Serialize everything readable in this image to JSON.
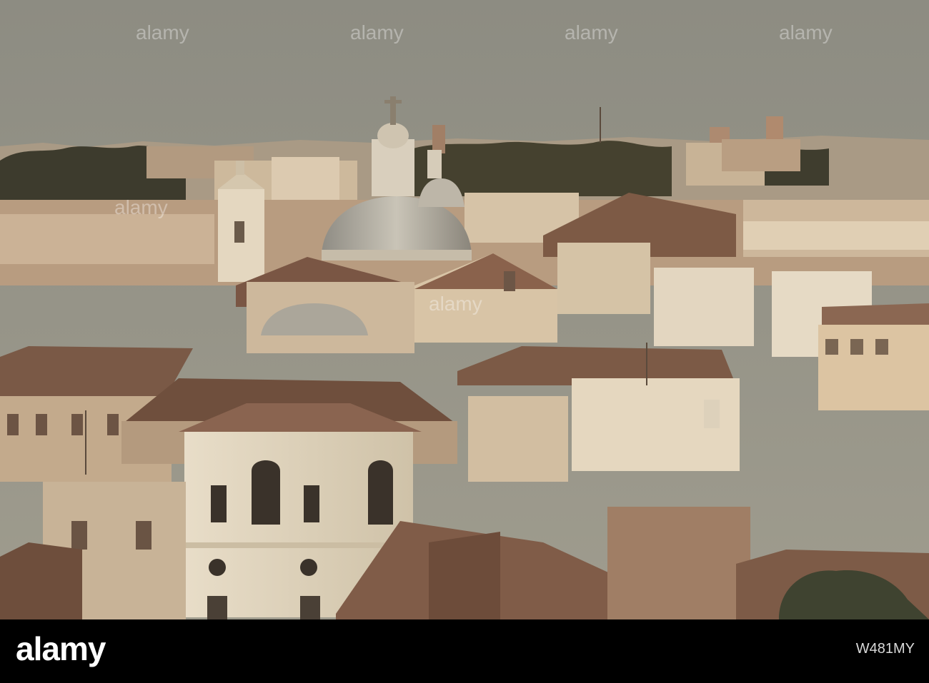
{
  "image": {
    "subject": "rome-skyline-rooftops",
    "palette": {
      "sky": "#8c8a7e",
      "distant": "#b7a790",
      "roof_dark": "#6e4a38",
      "roof_light": "#a07a62",
      "wall_light": "#e8dcc6",
      "wall_mid": "#c9b497",
      "dome": "#b0aba0",
      "trees": "#3b3a2c"
    }
  },
  "watermark": {
    "marks": [
      "alamy",
      "alamy",
      "alamy",
      "alamy",
      "alamy",
      "alamy"
    ]
  },
  "footer": {
    "brand": "alamy",
    "stock_id": "W481MY",
    "background": "#000000"
  }
}
